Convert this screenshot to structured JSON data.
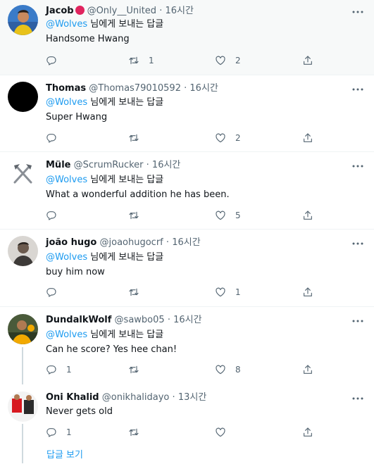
{
  "replying_label": "님에게 보내는 답글",
  "show_replies": "답글 보기",
  "accent_color": "#1d9bf0",
  "tweets": [
    {
      "name": "Jacob",
      "has_badge": true,
      "handle": "@Only__United",
      "sep": "·",
      "time": "16시간",
      "mention": "@Wolves",
      "text": "Handsome Hwang",
      "reply_count": "",
      "retweet_count": "1",
      "like_count": "2"
    },
    {
      "name": "Thomas",
      "handle": "@Thomas79010592",
      "sep": "·",
      "time": "16시간",
      "mention": "@Wolves",
      "text": "Super Hwang",
      "reply_count": "",
      "retweet_count": "",
      "like_count": "2"
    },
    {
      "name": "Müle",
      "handle": "@ScrumRucker",
      "sep": "·",
      "time": "16시간",
      "mention": "@Wolves",
      "text": "What a wonderful addition he has been.",
      "reply_count": "",
      "retweet_count": "",
      "like_count": "5"
    },
    {
      "name": "joão hugo",
      "handle": "@joaohugocrf",
      "sep": "·",
      "time": "16시간",
      "mention": "@Wolves",
      "text": "buy him now",
      "reply_count": "",
      "retweet_count": "",
      "like_count": "1"
    },
    {
      "name": "DundalkWolf",
      "handle": "@sawbo05",
      "sep": "·",
      "time": "16시간",
      "mention": "@Wolves",
      "text": "Can he score? Yes hee chan!",
      "reply_count": "1",
      "retweet_count": "",
      "like_count": "8"
    },
    {
      "name": "Oni Khalid",
      "handle": "@onikhalidayo",
      "sep": "·",
      "time": "13시간",
      "text": "Never gets old",
      "reply_count": "1",
      "retweet_count": "",
      "like_count": ""
    }
  ]
}
